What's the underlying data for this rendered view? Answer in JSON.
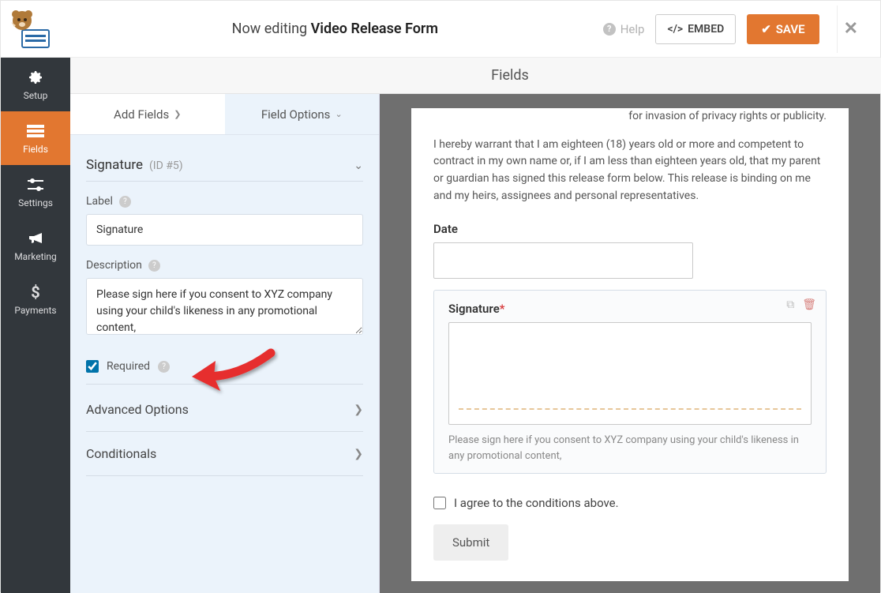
{
  "header": {
    "editing_prefix": "Now editing",
    "form_name": "Video Release Form",
    "help": "Help",
    "embed": "EMBED",
    "save": "SAVE"
  },
  "sidenav": {
    "setup": "Setup",
    "fields": "Fields",
    "settings": "Settings",
    "marketing": "Marketing",
    "payments": "Payments"
  },
  "panel": {
    "heading": "Fields",
    "tab_add": "Add Fields",
    "tab_options": "Field Options",
    "field_name": "Signature",
    "field_id": "(ID #5)",
    "label_label": "Label",
    "label_value": "Signature",
    "desc_label": "Description",
    "desc_value": "Please sign here if you consent to XYZ company using your child's likeness in any promotional content,",
    "required_label": "Required",
    "advanced": "Advanced Options",
    "conditionals": "Conditionals"
  },
  "preview": {
    "para1_partial": "for invasion of privacy rights or publicity.",
    "para2": "I hereby warrant that I am eighteen (18) years old or more and competent to contract in my own name or, if I am less than eighteen years old, that my parent or guardian has signed this release form below. This release is binding on me and my heirs, assignees and personal representatives.",
    "date_label": "Date",
    "sig_label": "Signature",
    "sig_desc": "Please sign here if you consent to XYZ company using your child's likeness in any promotional content,",
    "agree_label": "I agree to the conditions above.",
    "submit": "Submit"
  }
}
